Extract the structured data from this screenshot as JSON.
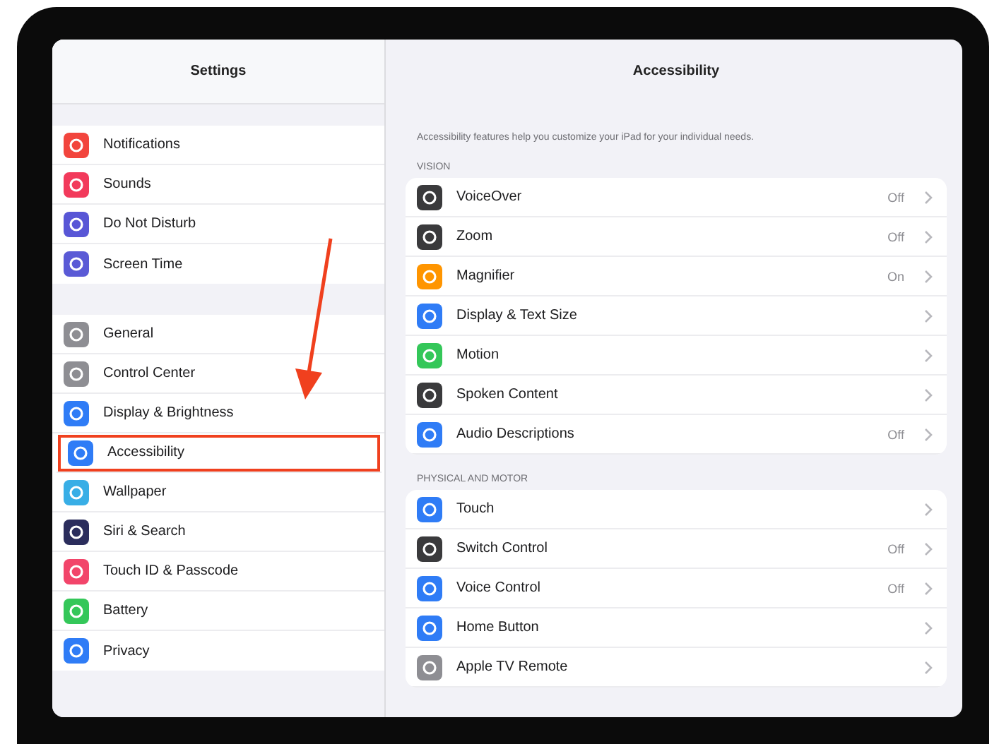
{
  "sidebar": {
    "title": "Settings",
    "groups": [
      [
        {
          "label": "Notifications",
          "color": "#f2453d",
          "highlighted": false
        },
        {
          "label": "Sounds",
          "color": "#f23a5b",
          "highlighted": false
        },
        {
          "label": "Do Not Disturb",
          "color": "#5856d6",
          "highlighted": false
        },
        {
          "label": "Screen Time",
          "color": "#5a5ad6",
          "highlighted": false
        }
      ],
      [
        {
          "label": "General",
          "color": "#8e8e93",
          "highlighted": false
        },
        {
          "label": "Control Center",
          "color": "#8e8e93",
          "highlighted": false
        },
        {
          "label": "Display & Brightness",
          "color": "#2f7cf6",
          "highlighted": false
        },
        {
          "label": "Accessibility",
          "color": "#2f7cf6",
          "highlighted": true
        },
        {
          "label": "Wallpaper",
          "color": "#38aee6",
          "highlighted": false
        },
        {
          "label": "Siri & Search",
          "color": "#2b2d5c",
          "highlighted": false
        },
        {
          "label": "Touch ID & Passcode",
          "color": "#f2456a",
          "highlighted": false
        },
        {
          "label": "Battery",
          "color": "#34c759",
          "highlighted": false
        },
        {
          "label": "Privacy",
          "color": "#2f7cf6",
          "highlighted": false
        }
      ]
    ]
  },
  "detail": {
    "title": "Accessibility",
    "description": "Accessibility features help you customize your iPad for your individual needs.",
    "sections": [
      {
        "heading": "VISION",
        "rows": [
          {
            "label": "VoiceOver",
            "value": "Off",
            "color": "#3a3a3c"
          },
          {
            "label": "Zoom",
            "value": "Off",
            "color": "#3a3a3c"
          },
          {
            "label": "Magnifier",
            "value": "On",
            "color": "#ff9500"
          },
          {
            "label": "Display & Text Size",
            "color": "#2f7cf6"
          },
          {
            "label": "Motion",
            "color": "#34c759"
          },
          {
            "label": "Spoken Content",
            "color": "#3a3a3c"
          },
          {
            "label": "Audio Descriptions",
            "value": "Off",
            "color": "#2f7cf6"
          }
        ]
      },
      {
        "heading": "PHYSICAL AND MOTOR",
        "rows": [
          {
            "label": "Touch",
            "color": "#2f7cf6"
          },
          {
            "label": "Switch Control",
            "value": "Off",
            "color": "#3a3a3c"
          },
          {
            "label": "Voice Control",
            "value": "Off",
            "color": "#2f7cf6"
          },
          {
            "label": "Home Button",
            "color": "#2f7cf6"
          },
          {
            "label": "Apple TV Remote",
            "color": "#8e8e93"
          }
        ]
      }
    ]
  }
}
